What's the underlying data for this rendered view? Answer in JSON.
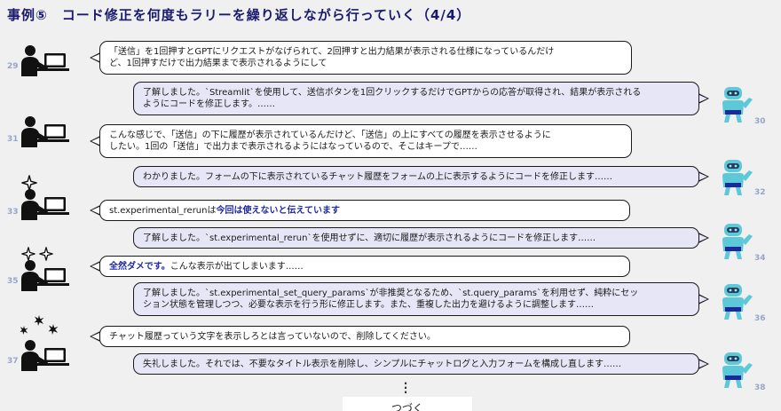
{
  "title": "事例⑤　コード修正を何度もラリーを繰り返しながら行っていく（4/4）",
  "messages": [
    {
      "n": "29",
      "role": "user",
      "l1": "「送信」を1回押すとGPTにリクエストがなげられて、2回押すと出力結果が表示される仕様になっているんだけ",
      "l2": "ど、1回押すだけで出力結果まで表示されるようにして"
    },
    {
      "n": "30",
      "role": "ai",
      "l1": "了解しました。`Streamlit`を使用して、送信ボタンを1回クリックするだけでGPTからの応答が取得され、結果が表示される",
      "l2": "ようにコードを修正します。……"
    },
    {
      "n": "31",
      "role": "user",
      "l1": "こんな感じで、「送信」の下に履歴が表示されているんだけど、「送信」の上にすべての履歴を表示させるように",
      "l2": "したい。1回の「送信」で出力まで表示されるようにはなっているので、そこはキープで……"
    },
    {
      "n": "32",
      "role": "ai",
      "l1": "わかりました。フォームの下に表示されているチャット履歴をフォームの上に表示するようにコードを修正します……"
    },
    {
      "n": "33",
      "role": "user",
      "l1_pre": "st.experimental_rerunは",
      "l1_hl": "今回は使えないと伝えています"
    },
    {
      "n": "34",
      "role": "ai",
      "l1": "了解しました。`st.experimental_rerun`を使用せずに、適切に履歴が表示されるようにコードを修正します……"
    },
    {
      "n": "35",
      "role": "user",
      "l1_hl": "全然ダメです。",
      "l1_post": "こんな表示が出てしまいます……"
    },
    {
      "n": "36",
      "role": "ai",
      "l1": "了解しました。`st.experimental_set_query_params`が非推奨となるため、`st.query_params`を利用せず、純粋にセッ",
      "l2": "ション状態を管理しつつ、必要な表示を行う形に修正します。また、重複した出力を避けるように調整します……"
    },
    {
      "n": "37",
      "role": "user",
      "l1": "チャット履歴っていう文字を表示しろとは言っていないので、削除してください。"
    },
    {
      "n": "38",
      "role": "ai",
      "l1": "失礼しました。それでは、不要なタイトル表示を削除し、シンプルにチャットログと入力フォームを構成し直します……"
    }
  ],
  "footer": {
    "continue_label": "つづく"
  },
  "colors": {
    "title": "#1a1a6e",
    "ai_bubble": "#e6e6f6",
    "user_bubble": "#ffffff",
    "highlight": "#1f28a8",
    "robot": "#5cc8d8",
    "number": "#9aa4c8"
  },
  "icons": {
    "user": "person-at-laptop-icon",
    "ai": "robot-icon",
    "mild": "sparkle-icon",
    "medium": "double-sparkle-icon",
    "strong": "anger-burst-icon"
  }
}
